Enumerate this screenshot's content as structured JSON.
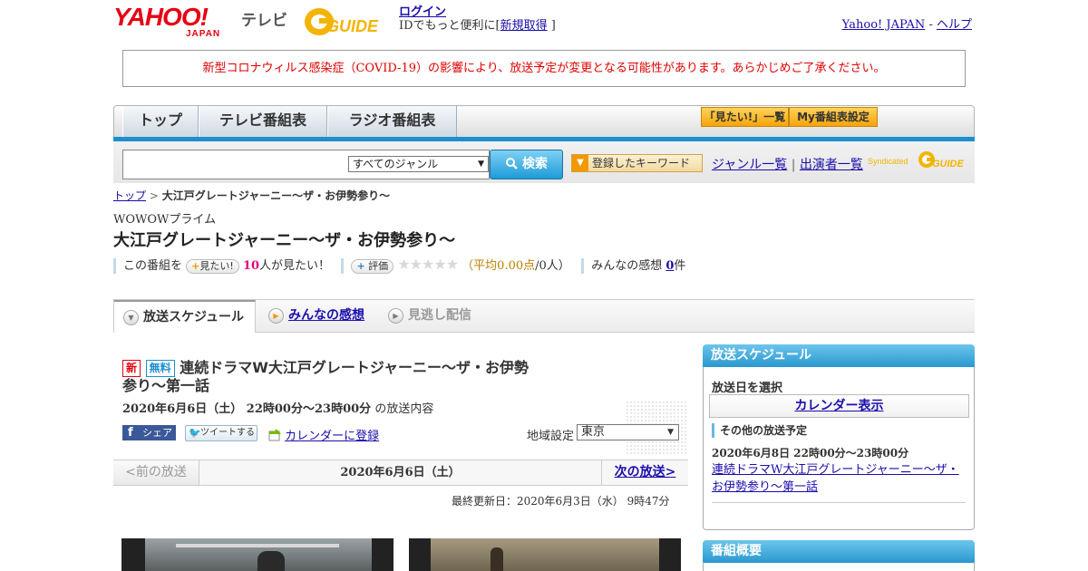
{
  "header": {
    "logo_text": "YAHOO!",
    "logo_sub": "JAPAN",
    "tv_label": "テレビ",
    "gguide_text": "GUIDE",
    "login": "ログイン",
    "login_desc": "IDでもっと便利に[",
    "signup": "新規取得",
    "login_close": "]",
    "yahoo_japan": "Yahoo! JAPAN",
    "dash": "-",
    "help": "ヘルプ"
  },
  "notice": "新型コロナウィルス感染症（COVID-19）の影響により、放送予定が変更となる可能性があります。あらかじめご了承ください。",
  "nav": {
    "tabs": [
      "トップ",
      "テレビ番組表",
      "ラジオ番組表"
    ],
    "want_list": "「見たい!」一覧",
    "my_settings": "My番組表設定"
  },
  "search": {
    "genre": "すべてのジャンル",
    "button": "検索",
    "keyword_btn": "登録したキーワード",
    "genre_list": "ジャンル一覧",
    "pipe": "|",
    "cast_list": "出演者一覧",
    "syndicated": "Syndicated",
    "syndicated_logo": "GUIDE"
  },
  "breadcrumb": {
    "top": "トップ",
    "sep": ">",
    "current": "大江戸グレートジャーニー～ザ・お伊勢参り～"
  },
  "program": {
    "channel": "WOWOWプライム",
    "title": "大江戸グレートジャーニー～ザ・お伊勢参り～",
    "kono_bangumi": "この番組を",
    "mitai_btn": "見たい!",
    "watchers": "10",
    "watchers_suffix": "人が見たい！",
    "rate_btn": "評価",
    "stars": "★★★★★",
    "avg_label": "（平均0.00点",
    "avg_count": "/0人）",
    "impressions": "みんなの感想",
    "impressions_count": "0",
    "impressions_unit": "件"
  },
  "content_tabs": {
    "schedule": "放送スケジュール",
    "reviews": "みんなの感想",
    "vod": "見逃し配信"
  },
  "episode": {
    "tag_new": "新",
    "tag_free": "無料",
    "title": "連続ドラマW大江戸グレートジャーニー～ザ・お伊勢参り～第一話",
    "air": "2020年6月6日（土） 22時00分～23時00分",
    "air_suffix": "の放送内容",
    "fb": "シェア",
    "tweet": "ツイートする",
    "calendar": "カレンダーに登録",
    "region_label": "地域設定",
    "region": "東京",
    "prev": "<前の放送",
    "date": "2020年6月6日（土）",
    "next": "次の放送>",
    "updated": "最終更新日：2020年6月3日（水） 9時47分"
  },
  "sidebar": {
    "schedule_title": "放送スケジュール",
    "select_date": "放送日を選択",
    "calendar_btn": "カレンダー表示",
    "other_title": "その他の放送予定",
    "other_date": "2020年6月8日 22時00分～23時00分",
    "other_link": "連続ドラマW大江戸グレートジャーニー～ザ・お伊勢参り～第一話",
    "summary_title": "番組概要"
  },
  "colors": {
    "accent": "#1d8fd0",
    "notice_red": "#e00000",
    "brand_red": "#e60012"
  }
}
